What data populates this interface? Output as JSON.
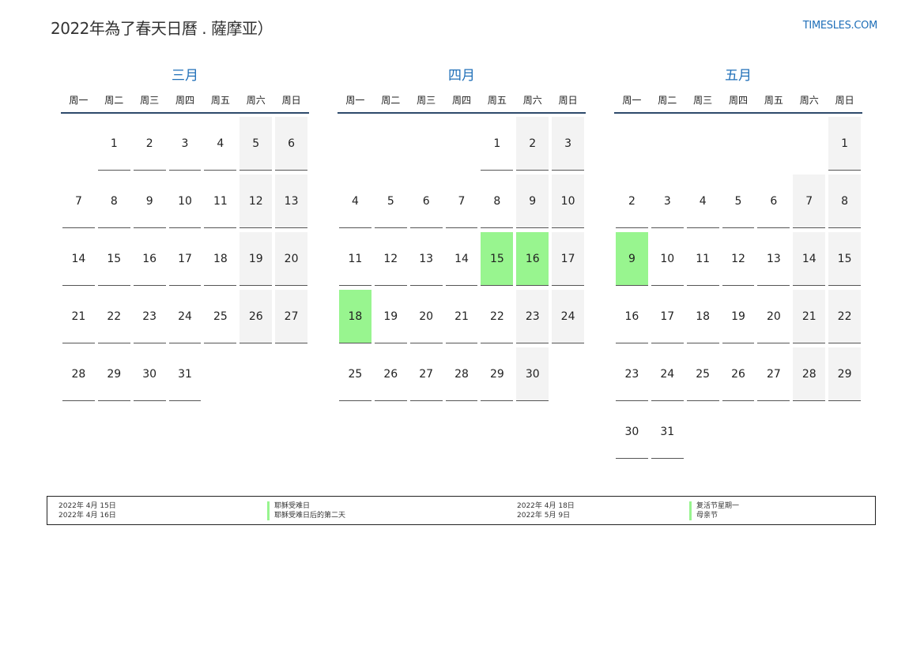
{
  "header": {
    "title": "2022年為了春天日曆 . 薩摩亚）",
    "site": "TIMESLES.COM"
  },
  "weekdays": [
    "周一",
    "周二",
    "周三",
    "周四",
    "周五",
    "周六",
    "周日"
  ],
  "months": [
    {
      "name": "三月",
      "weeks": [
        [
          [
            ""
          ],
          [
            "1"
          ],
          [
            "2"
          ],
          [
            "3"
          ],
          [
            "4"
          ],
          [
            "5",
            "w"
          ],
          [
            "6",
            "w"
          ]
        ],
        [
          [
            "7"
          ],
          [
            "8"
          ],
          [
            "9"
          ],
          [
            "10"
          ],
          [
            "11"
          ],
          [
            "12",
            "w"
          ],
          [
            "13",
            "w"
          ]
        ],
        [
          [
            "14"
          ],
          [
            "15"
          ],
          [
            "16"
          ],
          [
            "17"
          ],
          [
            "18"
          ],
          [
            "19",
            "w"
          ],
          [
            "20",
            "w"
          ]
        ],
        [
          [
            "21"
          ],
          [
            "22"
          ],
          [
            "23"
          ],
          [
            "24"
          ],
          [
            "25"
          ],
          [
            "26",
            "w"
          ],
          [
            "27",
            "w"
          ]
        ],
        [
          [
            "28"
          ],
          [
            "29"
          ],
          [
            "30"
          ],
          [
            "31"
          ],
          [
            ""
          ],
          [
            ""
          ],
          [
            ""
          ]
        ]
      ]
    },
    {
      "name": "四月",
      "weeks": [
        [
          [
            ""
          ],
          [
            ""
          ],
          [
            ""
          ],
          [
            ""
          ],
          [
            "1"
          ],
          [
            "2",
            "w"
          ],
          [
            "3",
            "w"
          ]
        ],
        [
          [
            "4"
          ],
          [
            "5"
          ],
          [
            "6"
          ],
          [
            "7"
          ],
          [
            "8"
          ],
          [
            "9",
            "w"
          ],
          [
            "10",
            "w"
          ]
        ],
        [
          [
            "11"
          ],
          [
            "12"
          ],
          [
            "13"
          ],
          [
            "14"
          ],
          [
            "15",
            "h"
          ],
          [
            "16",
            "h"
          ],
          [
            "17",
            "w"
          ]
        ],
        [
          [
            "18",
            "h"
          ],
          [
            "19"
          ],
          [
            "20"
          ],
          [
            "21"
          ],
          [
            "22"
          ],
          [
            "23",
            "w"
          ],
          [
            "24",
            "w"
          ]
        ],
        [
          [
            "25"
          ],
          [
            "26"
          ],
          [
            "27"
          ],
          [
            "28"
          ],
          [
            "29"
          ],
          [
            "30",
            "w"
          ],
          [
            ""
          ]
        ]
      ]
    },
    {
      "name": "五月",
      "weeks": [
        [
          [
            ""
          ],
          [
            ""
          ],
          [
            ""
          ],
          [
            ""
          ],
          [
            ""
          ],
          [
            ""
          ],
          [
            "1",
            "w"
          ]
        ],
        [
          [
            "2"
          ],
          [
            "3"
          ],
          [
            "4"
          ],
          [
            "5"
          ],
          [
            "6"
          ],
          [
            "7",
            "w"
          ],
          [
            "8",
            "w"
          ]
        ],
        [
          [
            "9",
            "h"
          ],
          [
            "10"
          ],
          [
            "11"
          ],
          [
            "12"
          ],
          [
            "13"
          ],
          [
            "14",
            "w"
          ],
          [
            "15",
            "w"
          ]
        ],
        [
          [
            "16"
          ],
          [
            "17"
          ],
          [
            "18"
          ],
          [
            "19"
          ],
          [
            "20"
          ],
          [
            "21",
            "w"
          ],
          [
            "22",
            "w"
          ]
        ],
        [
          [
            "23"
          ],
          [
            "24"
          ],
          [
            "25"
          ],
          [
            "26"
          ],
          [
            "27"
          ],
          [
            "28",
            "w"
          ],
          [
            "29",
            "w"
          ]
        ],
        [
          [
            "30"
          ],
          [
            "31"
          ],
          [
            ""
          ],
          [
            ""
          ],
          [
            ""
          ],
          [
            ""
          ],
          [
            ""
          ]
        ]
      ]
    }
  ],
  "legend": {
    "col1_dates": [
      "2022年 4月 15日",
      "2022年 4月 16日"
    ],
    "col1_names": [
      "耶稣受难日",
      "耶稣受难日后的第二天"
    ],
    "col2_dates": [
      "2022年 4月 18日",
      "2022年 5月 9日"
    ],
    "col2_names": [
      "复活节星期一",
      "母亲节"
    ]
  },
  "colors": {
    "holiday": "#98f58f",
    "weekend": "#f3f3f3",
    "accent": "#1f6fb8",
    "rule": "#2e4a6b"
  }
}
